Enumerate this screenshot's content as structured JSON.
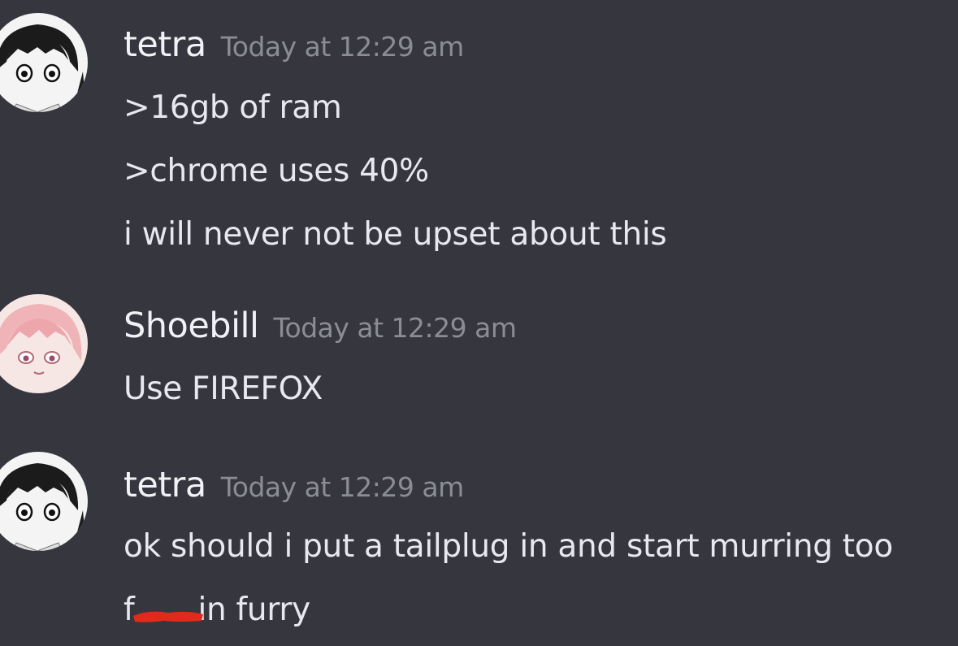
{
  "messages": [
    {
      "username": "tetra",
      "timestamp": "Today at 12:29 am",
      "avatar_icon": "anime-girl-black-hair-avatar",
      "lines": [
        ">16gb of ram",
        ">chrome uses 40%",
        "i will never not be upset about this"
      ]
    },
    {
      "username": "Shoebill",
      "timestamp": "Today at 12:29 am",
      "avatar_icon": "anime-character-pink-hair-avatar",
      "lines": [
        "Use FIREFOX"
      ]
    },
    {
      "username": "tetra",
      "timestamp": "Today at 12:29 am",
      "avatar_icon": "anime-girl-black-hair-avatar",
      "lines": [
        "ok should i put a tailplug in and start murring too",
        "f",
        "in furry"
      ]
    }
  ],
  "colors": {
    "background": "#36363f",
    "username": "#f2f2f6",
    "timestamp": "#8b8d96",
    "message_text": "#e8e8ee",
    "redaction_mark": "#e02a1c"
  }
}
